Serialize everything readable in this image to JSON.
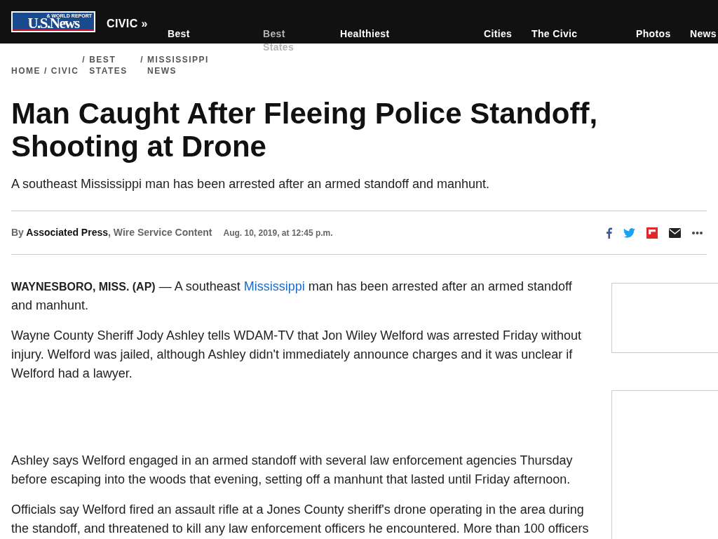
{
  "header": {
    "logo": "U.S.News",
    "logo_tag": "& WORLD REPORT",
    "section": "CIVIC »",
    "nav": [
      {
        "label": "Best",
        "selected": false
      },
      {
        "label": "Best States",
        "selected": true
      },
      {
        "label": "Healthiest",
        "selected": false
      },
      {
        "label": "Cities",
        "selected": false
      },
      {
        "label": "The Civic",
        "selected": false
      },
      {
        "label": "Photos",
        "selected": false
      },
      {
        "label": "News",
        "selected": false
      }
    ]
  },
  "breadcrumbs": [
    {
      "label": "HOME"
    },
    {
      "separator": "/",
      "label": "CIVIC"
    },
    {
      "separator": "/",
      "label": "BEST STATES"
    },
    {
      "separator": "/",
      "label": "MISSISSIPPI NEWS"
    }
  ],
  "article": {
    "title": "Man Caught After Fleeing Police Standoff, Shooting at Drone",
    "subtitle": "A southeast Mississippi man has been arrested after an armed standoff and manhunt.",
    "byline": {
      "by": "By",
      "author": "Associated Press",
      "source": ", Wire Service Content",
      "date": "Aug. 10, 2019, at 12:45 p.m."
    },
    "share": [
      {
        "kind": "facebook"
      },
      {
        "kind": "twitter"
      },
      {
        "kind": "flipboard"
      },
      {
        "kind": "email"
      },
      {
        "kind": "more"
      }
    ],
    "paragraphs": [
      {
        "dateline": "WAYNESBORO, MISS. (AP)",
        "before": " — A southeast ",
        "link": "Mississippi",
        "after": " man has been arrested after an armed standoff and manhunt."
      },
      {
        "text": "Wayne County Sheriff Jody Ashley tells WDAM-TV that Jon Wiley Welford was arrested Friday without injury. Welford was jailed, although Ashley didn't immediately announce charges and it was unclear if Welford had a lawyer."
      },
      {
        "text": "Ashley says Welford engaged in an armed standoff with several law enforcement agencies Thursday before escaping into the woods that evening, setting off a manhunt that lasted until Friday afternoon."
      },
      {
        "text": "Officials say Welford fired an assault rifle at a Jones County sheriff's drone operating in the area during the standoff, and threatened to kill any law enforcement officers he encountered. More than 100 officers"
      }
    ]
  }
}
